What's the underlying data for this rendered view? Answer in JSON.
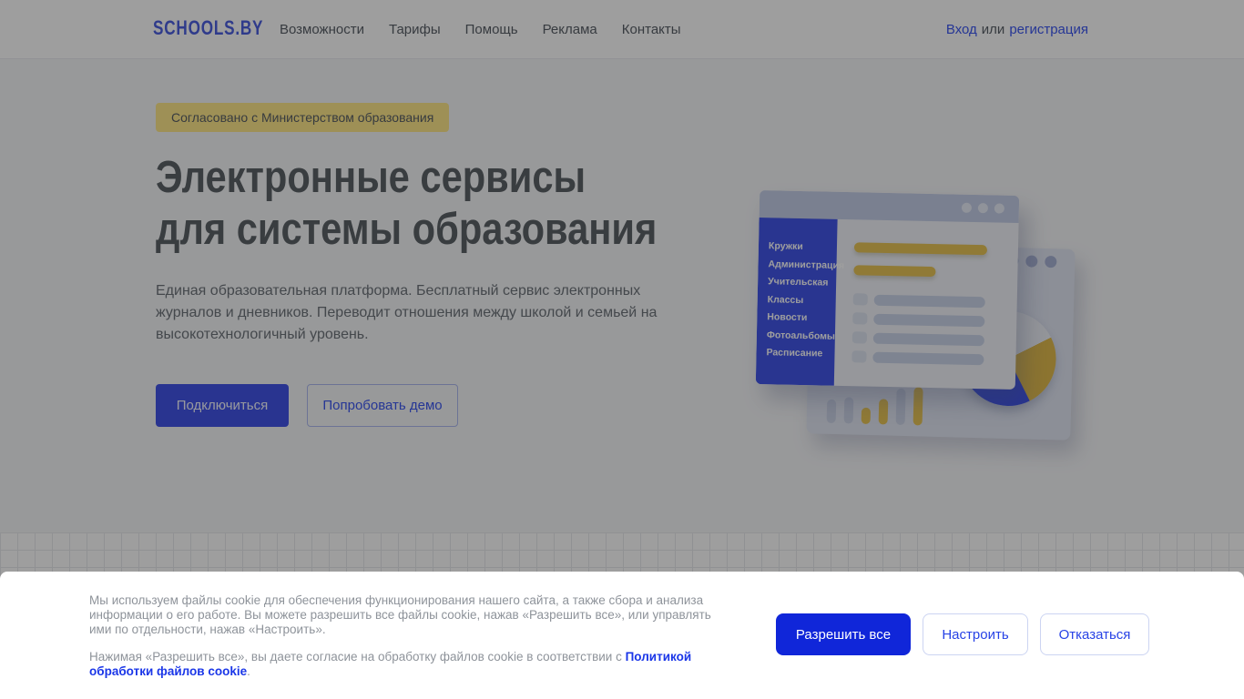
{
  "header": {
    "logo": "SCHOOLS.BY",
    "nav_items": [
      {
        "label": "Возможности"
      },
      {
        "label": "Тарифы"
      },
      {
        "label": "Помощь"
      },
      {
        "label": "Реклама"
      },
      {
        "label": "Контакты"
      }
    ],
    "auth": {
      "login": "Вход",
      "separator": "или",
      "register": "регистрация"
    }
  },
  "hero": {
    "badge": "Согласовано с Министерством образования",
    "title_line1": "Электронные сервисы",
    "title_line2": "для системы образования",
    "description": "Единая образовательная платформа. Бесплатный сервис электронных журналов и дневников. Переводит отношения между школой и семьей на высокотехнологичный уровень.",
    "primary_button": "Подключиться",
    "secondary_button": "Попробовать демо"
  },
  "illustration": {
    "sidebar_items": [
      "Кружки",
      "Администрация",
      "Учительская",
      "Классы",
      "Новости",
      "Фотоальбомы",
      "Расписание"
    ]
  },
  "cookie_banner": {
    "paragraph1_lines": [
      "Мы используем файлы cookie для обеспечения функционирования нашего сайта, а также сбора и анализа",
      "информации о его работе. Вы можете разрешить все файлы cookie, нажав «Разрешить все», или управлять",
      "ими по отдельности, нажав «Настроить»."
    ],
    "paragraph2_prefix": "Нажимая «Разрешить все», вы даете согласие на обработку файлов cookie в соответствии с ",
    "policy_link": "Политикой обработки файлов cookie",
    "paragraph2_suffix": ".",
    "buttons": {
      "accept": "Разрешить все",
      "configure": "Настроить",
      "decline": "Отказаться"
    }
  },
  "colors": {
    "accent_blue": "#1026d9",
    "brand_blue": "#4356e8",
    "badge_yellow": "#ffe98c",
    "chart_yellow": "#e8c558"
  }
}
